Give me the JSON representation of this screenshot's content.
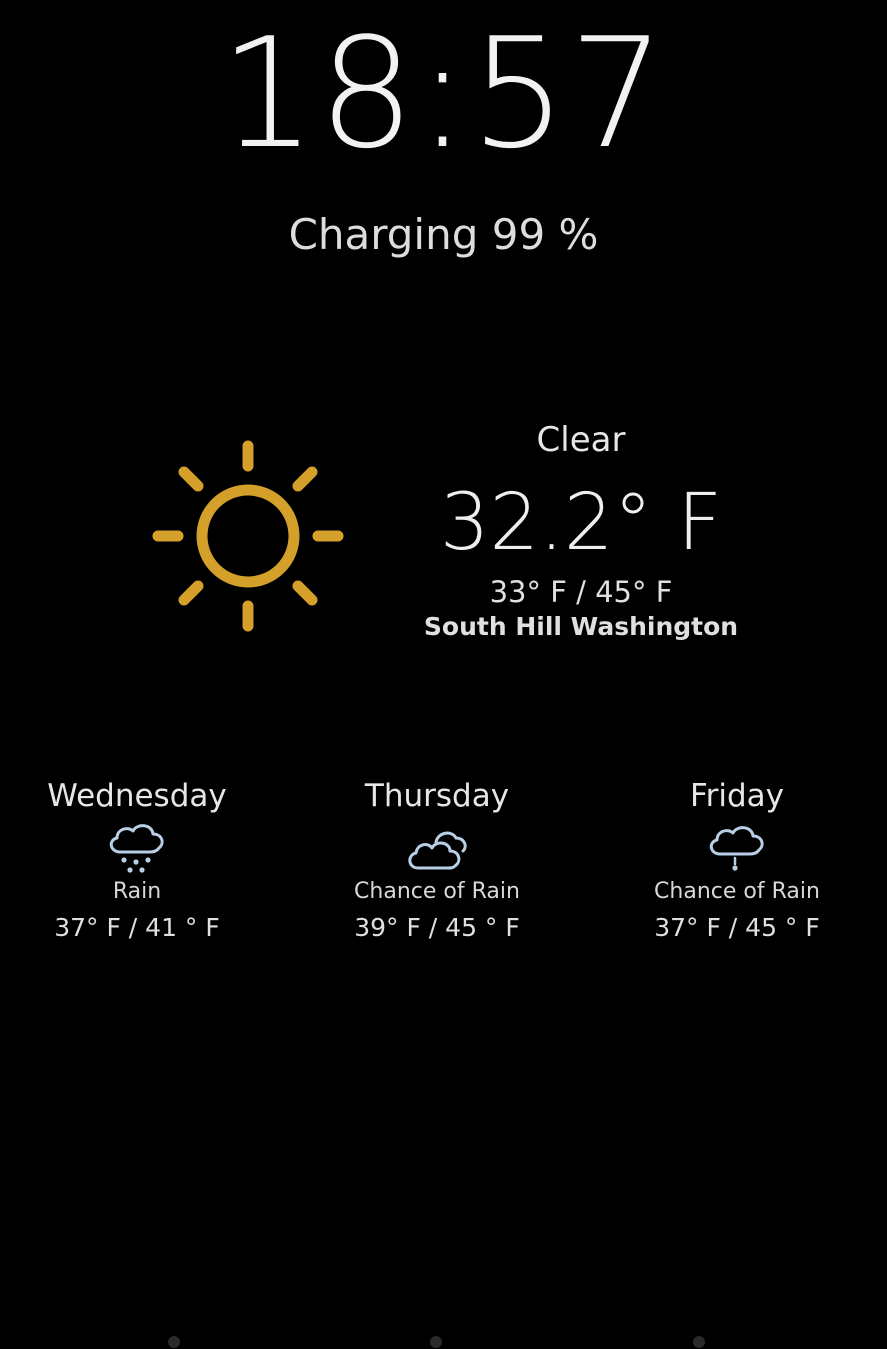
{
  "clock": {
    "time": "18:57"
  },
  "status": {
    "charging_text": "Charging 99 %"
  },
  "current": {
    "icon": "sun-icon",
    "condition": "Clear",
    "temperature": "32.2° F",
    "range": "33° F / 45° F",
    "location": "South Hill Washington"
  },
  "forecast": [
    {
      "day": "Wednesday",
      "icon": "cloud-rain-icon",
      "condition": "Rain",
      "range": "37° F / 41 ° F"
    },
    {
      "day": "Thursday",
      "icon": "cloud-icon",
      "condition": "Chance of Rain",
      "range": "39° F / 45 ° F"
    },
    {
      "day": "Friday",
      "icon": "cloud-drizzle-icon",
      "condition": "Chance of Rain",
      "range": "37° F / 45 ° F"
    }
  ],
  "colors": {
    "background": "#000000",
    "sun": "#d4a02a",
    "cloud": "#b9cfe6",
    "text": "#ffffff"
  }
}
